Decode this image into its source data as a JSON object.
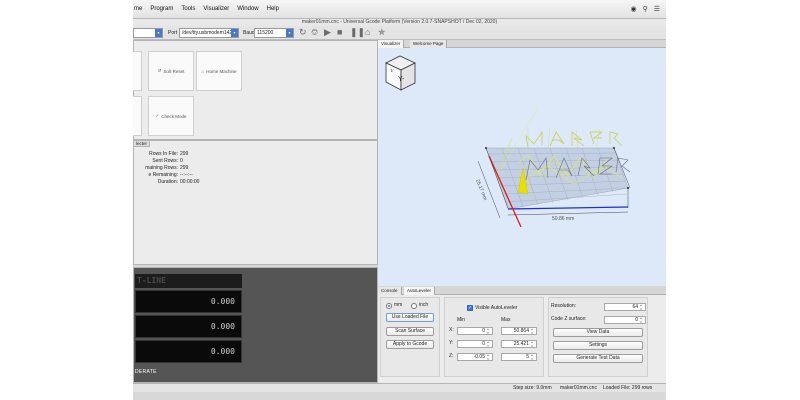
{
  "menubar": {
    "items": [
      "me",
      "Program",
      "Tools",
      "Visualizer",
      "Window",
      "Help"
    ]
  },
  "title": "maker01mm.cnc - Universal Gcode Platform (Version 2.0.7-SNAPSHOT / Dec 02, 2020)",
  "toolbar": {
    "port_label": "Port",
    "port_value": "/dev/tty.usbmodem1421",
    "baud_label": "Baud",
    "baud_value": "115200"
  },
  "actions": {
    "soft_reset": "Soft Reset",
    "home_machine": "Home Machine",
    "check_mode": "Check Mode"
  },
  "state_panel": {
    "tab": "lecter",
    "rows": [
      {
        "key": "Rows In File:",
        "value": "299"
      },
      {
        "key": "Sent Rows:",
        "value": "0"
      },
      {
        "key": "maining Rows:",
        "value": "299"
      },
      {
        "key": "e Remaining:",
        "value": "--:--:--"
      },
      {
        "key": "Duration:",
        "value": "00:00:00"
      }
    ]
  },
  "dro": {
    "header": "T-LINE",
    "x": "0.000",
    "y": "0.000",
    "z": "0.000",
    "footer": "DERATE"
  },
  "visualizer": {
    "tabs": [
      "Visualizer",
      "Welcome Page"
    ],
    "view_cube_label": "Y-",
    "dim_x": "50.86 mm",
    "dim_y": "25.17 mm",
    "text": "MAKER"
  },
  "bottom_tabs": [
    "Console",
    "AutoLeveler"
  ],
  "autoleveler": {
    "unit_mm": "mm",
    "unit_inch": "inch",
    "use_loaded_file": "Use Loaded File",
    "scan_surface": "Scan Surface",
    "apply_to_gcode": "Apply to Gcode",
    "visible_autoleveler": "Visible AutoLeveler",
    "min_label": "Min",
    "max_label": "Max",
    "x_label": "X:",
    "y_label": "Y:",
    "z_label": "Z:",
    "x_min": "0",
    "x_max": "50.864",
    "y_min": "0",
    "y_max": "25.421",
    "z_min": "-0.05",
    "z_max": "5",
    "resolution_label": "Resolution:",
    "resolution_value": "64",
    "code_z_label": "Code Z surface:",
    "code_z_value": "0",
    "view_data": "View Data",
    "settings": "Settings",
    "generate_test_data": "Generate Test Data"
  },
  "statusbar": {
    "step_size": "Step size: 9.0mm",
    "file": "maker01mm.cnc",
    "loaded": "Loaded File: 299 rows"
  }
}
